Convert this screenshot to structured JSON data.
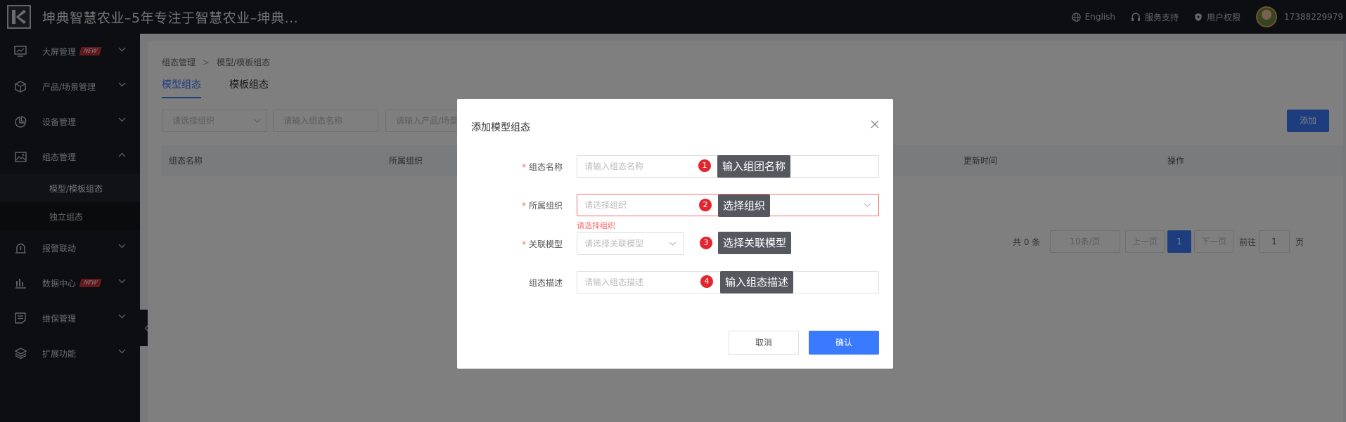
{
  "header": {
    "title": "坤典智慧农业–5年专注于智慧农业–坤典...",
    "links": [
      "English",
      "服务支持",
      "用户权限"
    ],
    "phone": "17388229979"
  },
  "sidebar": {
    "items": [
      {
        "label": "大屏管理",
        "badge": "NEW",
        "icon": "monitor-icon"
      },
      {
        "label": "产品/场景管理",
        "icon": "cube-icon"
      },
      {
        "label": "设备管理",
        "icon": "pie-chart-icon"
      },
      {
        "label": "组态管理",
        "icon": "image-icon",
        "expanded": true
      },
      {
        "label": "报警联动",
        "icon": "alarm-icon"
      },
      {
        "label": "数据中心",
        "badge": "NEW",
        "icon": "bar-chart-icon"
      },
      {
        "label": "维保管理",
        "icon": "clipboard-icon"
      },
      {
        "label": "扩展功能",
        "icon": "layers-icon"
      }
    ],
    "sub_items": [
      "模型/模板组态",
      "独立组态"
    ]
  },
  "main": {
    "breadcrumb": [
      "组态管理",
      "模型/模板组态"
    ],
    "tabs": [
      "模型组态",
      "模板组态"
    ],
    "filters": {
      "org_placeholder": "请选择组织",
      "name_placeholder": "请输入组态名称",
      "product_placeholder": "请输入产品/场景"
    },
    "add_label": "添加",
    "columns": [
      "组态名称",
      "所属组织",
      "更新时间",
      "操作"
    ],
    "pagination": {
      "total": "共 0 条",
      "page_size": "10条/页",
      "prev": "上一页",
      "current": "1",
      "next": "下一页",
      "goto": "前往",
      "goto_value": "1",
      "page_suffix": "页"
    }
  },
  "modal": {
    "title": "添加模型组态",
    "fields": [
      {
        "label": "组态名称",
        "required": true,
        "placeholder": "请输入组态名称"
      },
      {
        "label": "所属组织",
        "required": true,
        "placeholder": "请选择组织"
      },
      {
        "label": "关联模型",
        "required": true,
        "placeholder": "请选择关联模型"
      },
      {
        "label": "组态描述",
        "required": false,
        "placeholder": "请输入组态描述"
      }
    ],
    "error": "请选择组织",
    "cancel": "取消",
    "confirm": "确认"
  },
  "annotations": [
    {
      "number": "1",
      "text": "输入组团名称"
    },
    {
      "number": "2",
      "text": "选择组织"
    },
    {
      "number": "3",
      "text": "选择关联模型"
    },
    {
      "number": "4",
      "text": "输入组态描述"
    }
  ],
  "colors": {
    "primary": "#3a7afe",
    "sidebar": "#1b1d24",
    "marker": "#e3262e",
    "error": "#f56c6c"
  }
}
